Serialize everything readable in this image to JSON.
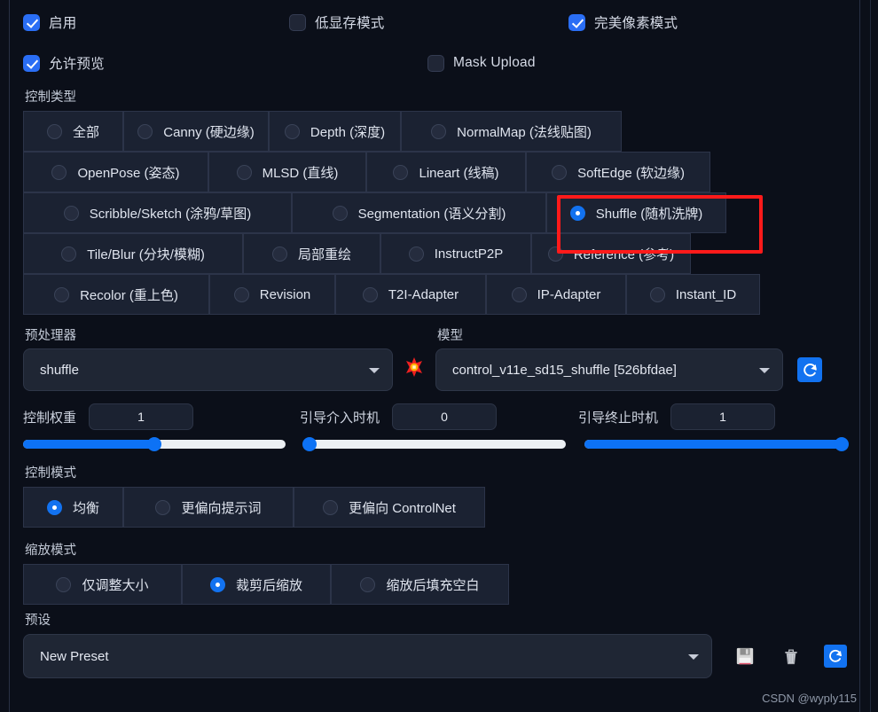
{
  "checkboxes": {
    "row1": [
      {
        "label": "启用",
        "checked": true
      },
      {
        "label": "低显存模式",
        "checked": false
      },
      {
        "label": "完美像素模式",
        "checked": true
      }
    ],
    "row2": [
      {
        "label": "允许预览",
        "checked": true
      },
      {
        "label": "Mask Upload",
        "checked": false
      }
    ]
  },
  "control_type": {
    "section_label": "控制类型",
    "rows": [
      [
        {
          "label": "全部",
          "selected": false
        },
        {
          "label": "Canny (硬边缘)",
          "selected": false
        },
        {
          "label": "Depth (深度)",
          "selected": false
        },
        {
          "label": "NormalMap (法线贴图)",
          "selected": false
        }
      ],
      [
        {
          "label": "OpenPose (姿态)",
          "selected": false
        },
        {
          "label": "MLSD (直线)",
          "selected": false
        },
        {
          "label": "Lineart (线稿)",
          "selected": false
        },
        {
          "label": "SoftEdge (软边缘)",
          "selected": false
        }
      ],
      [
        {
          "label": "Scribble/Sketch (涂鸦/草图)",
          "selected": false
        },
        {
          "label": "Segmentation (语义分割)",
          "selected": false
        },
        {
          "label": "Shuffle (随机洗牌)",
          "selected": true
        }
      ],
      [
        {
          "label": "Tile/Blur (分块/模糊)",
          "selected": false
        },
        {
          "label": "局部重绘",
          "selected": false
        },
        {
          "label": "InstructP2P",
          "selected": false
        },
        {
          "label": "Reference (参考)",
          "selected": false
        }
      ],
      [
        {
          "label": "Recolor (重上色)",
          "selected": false
        },
        {
          "label": "Revision",
          "selected": false
        },
        {
          "label": "T2I-Adapter",
          "selected": false
        },
        {
          "label": "IP-Adapter",
          "selected": false
        },
        {
          "label": "Instant_ID",
          "selected": false
        }
      ]
    ],
    "highlight_target": "Shuffle (随机洗牌)",
    "highlight_color": "#ff1a1a"
  },
  "preprocessor": {
    "label": "预处理器",
    "value": "shuffle",
    "explosion_icon": "explosion-icon"
  },
  "model": {
    "label": "模型",
    "value": "control_v11e_sd15_shuffle [526bfdae]",
    "refresh_icon": "refresh-icon"
  },
  "sliders": [
    {
      "name": "控制权重",
      "value": "1",
      "percent": 50
    },
    {
      "name": "引导介入时机",
      "value": "0",
      "percent": 0
    },
    {
      "name": "引导终止时机",
      "value": "1",
      "percent": 100
    }
  ],
  "control_mode": {
    "section_label": "控制模式",
    "options": [
      {
        "label": "均衡",
        "selected": true
      },
      {
        "label": "更偏向提示词",
        "selected": false
      },
      {
        "label": "更偏向 ControlNet",
        "selected": false
      }
    ]
  },
  "resize_mode": {
    "section_label": "缩放模式",
    "options": [
      {
        "label": "仅调整大小",
        "selected": false
      },
      {
        "label": "裁剪后缩放",
        "selected": true
      },
      {
        "label": "缩放后填充空白",
        "selected": false
      }
    ]
  },
  "preset": {
    "section_label": "预设",
    "value": "New Preset",
    "save_icon": "floppy-disk-icon",
    "delete_icon": "trash-can-icon",
    "refresh_icon": "refresh-icon"
  },
  "watermark": "CSDN @wyply115",
  "colors": {
    "accent": "#1272f0",
    "background": "#0b0f19",
    "button": "#1b2232",
    "highlight": "#ff1a1a"
  }
}
